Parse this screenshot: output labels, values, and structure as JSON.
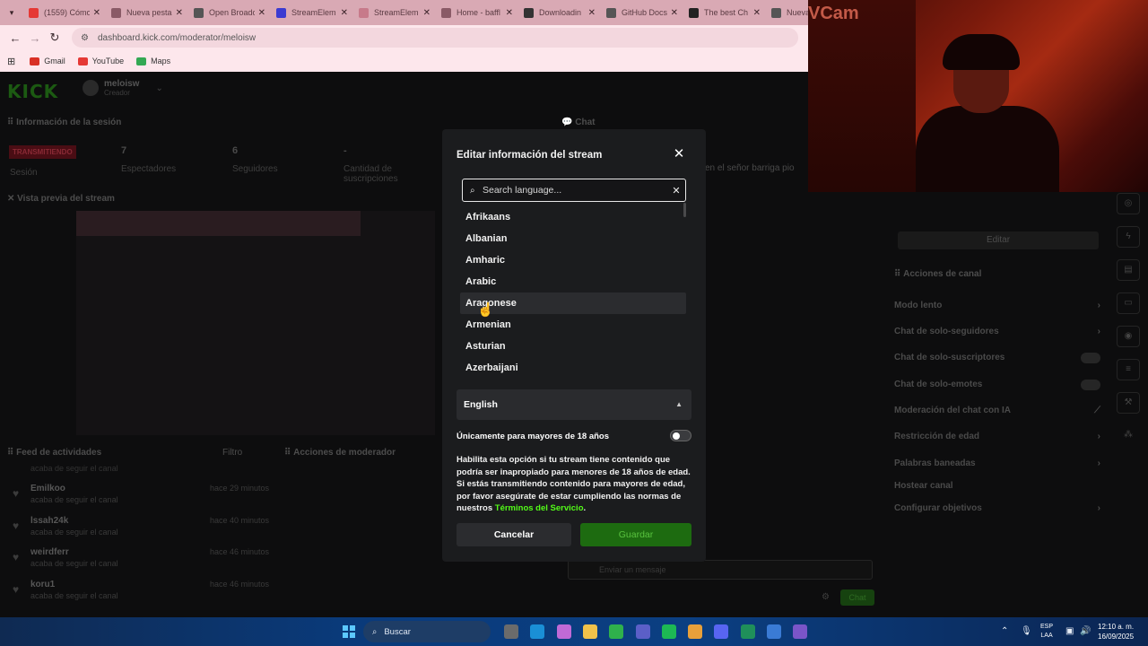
{
  "browser": {
    "tabs": [
      {
        "label": "(1559) Cómo",
        "color": "#e53935"
      },
      {
        "label": "Nueva pestaña",
        "color": "#8a5a66"
      },
      {
        "label": "Open Broadc",
        "color": "#555555"
      },
      {
        "label": "StreamElem",
        "color": "#3b3bd1"
      },
      {
        "label": "StreamElem",
        "color": "#c77a8a"
      },
      {
        "label": "Home - baffl",
        "color": "#8a5a66"
      },
      {
        "label": "Downloadin",
        "color": "#333333"
      },
      {
        "label": "GitHub Docs",
        "color": "#555555"
      },
      {
        "label": "The best Ch",
        "color": "#222222"
      },
      {
        "label": "Nueva",
        "color": "#555555"
      }
    ],
    "url": "dashboard.kick.com/moderator/meloisw",
    "bookmarks": [
      {
        "label": "Gmail",
        "color": "#d93025"
      },
      {
        "label": "YouTube",
        "color": "#e53935"
      },
      {
        "label": "Maps",
        "color": "#34a853"
      }
    ]
  },
  "dashboard": {
    "logo": "KICK",
    "username": "meloisw",
    "role": "Creador",
    "session_title": "Información de la sesión",
    "live_badge": "TRANSMITIENDO",
    "session_label": "Sesión",
    "stats": [
      {
        "value": "7",
        "label": "Espectadores"
      },
      {
        "value": "6",
        "label": "Seguidores"
      },
      {
        "value": "-",
        "label": "Cantidad de suscripciones"
      }
    ],
    "preview_title": "Vista previa del stream",
    "chat_title": "Chat",
    "chat_message": "en el señor barriga pio",
    "feed_title": "Feed de actividades",
    "feed_filter": "Filtro",
    "mod_actions_title": "Acciones de moderador",
    "feed_top_text": "acaba de seguir el canal",
    "feed": [
      {
        "name": "Emilkoo",
        "sub": "acaba de seguir el canal",
        "time": "hace 29 minutos"
      },
      {
        "name": "lssah24k",
        "sub": "acaba de seguir el canal",
        "time": "hace 40 minutos"
      },
      {
        "name": "weirdferr",
        "sub": "acaba de seguir el canal",
        "time": "hace 46 minutos"
      },
      {
        "name": "koru1",
        "sub": "acaba de seguir el canal",
        "time": "hace 46 minutos"
      }
    ],
    "edit_button": "Editar",
    "channel_actions_title": "Acciones de canal",
    "channel_actions": [
      {
        "label": "Modo lento",
        "kind": "chevron"
      },
      {
        "label": "Chat de solo-seguidores",
        "kind": "chevron"
      },
      {
        "label": "Chat de solo-suscriptores",
        "kind": "toggle"
      },
      {
        "label": "Chat de solo-emotes",
        "kind": "toggle"
      },
      {
        "label": "Moderación del chat con IA",
        "kind": "icon"
      },
      {
        "label": "Restricción de edad",
        "kind": "chevron"
      },
      {
        "label": "Palabras baneadas",
        "kind": "chevron"
      },
      {
        "label": "Hostear canal",
        "kind": "none"
      },
      {
        "label": "Configurar objetivos",
        "kind": "chevron"
      }
    ],
    "chat_placeholder": "Enviar un mensaje",
    "chat_send": "Chat"
  },
  "webcam": {
    "label": "VCam"
  },
  "modal": {
    "title": "Editar información del stream",
    "search_placeholder": "Search language...",
    "languages": [
      "Afrikaans",
      "Albanian",
      "Amharic",
      "Arabic",
      "Aragonese",
      "Armenian",
      "Asturian",
      "Azerbaijani"
    ],
    "hovered_language": "Aragonese",
    "selected_language": "English",
    "adult_label": "Únicamente para mayores de 18 años",
    "adult_enabled": false,
    "adult_desc_1": "Habilita esta opción si tu stream tiene contenido que podría ser inapropiado para menores de 18 años de edad. Si estás transmitiendo contenido para mayores de edad, por favor asegúrate de estar cumpliendo las normas de nuestros ",
    "terms_link": "Términos del Servicio",
    "adult_desc_end": ".",
    "cancel": "Cancelar",
    "save": "Guardar",
    "accent": "#53fc18"
  },
  "taskbar": {
    "search": "Buscar",
    "lang_top": "ESP",
    "lang_bottom": "LAA",
    "time": "12:10 a. m.",
    "date": "16/09/2025",
    "apps": [
      {
        "name": "file-explorer-dark-icon",
        "color": "#6b6b6b"
      },
      {
        "name": "edge-icon",
        "color": "#1a8fd6"
      },
      {
        "name": "copilot-icon",
        "color": "#c06ad6"
      },
      {
        "name": "folder-icon",
        "color": "#f0c24a"
      },
      {
        "name": "chrome-icon",
        "color": "#2fb14c"
      },
      {
        "name": "teams-icon",
        "color": "#5b5fc7"
      },
      {
        "name": "spotify-icon",
        "color": "#1db954"
      },
      {
        "name": "chrome-active-icon",
        "color": "#e8a03a"
      },
      {
        "name": "discord-icon",
        "color": "#5865f2"
      },
      {
        "name": "app-green-icon",
        "color": "#1f8f5a"
      },
      {
        "name": "app-blue-icon",
        "color": "#3a7bd5"
      },
      {
        "name": "app-purple-icon",
        "color": "#7a55c8"
      }
    ]
  }
}
